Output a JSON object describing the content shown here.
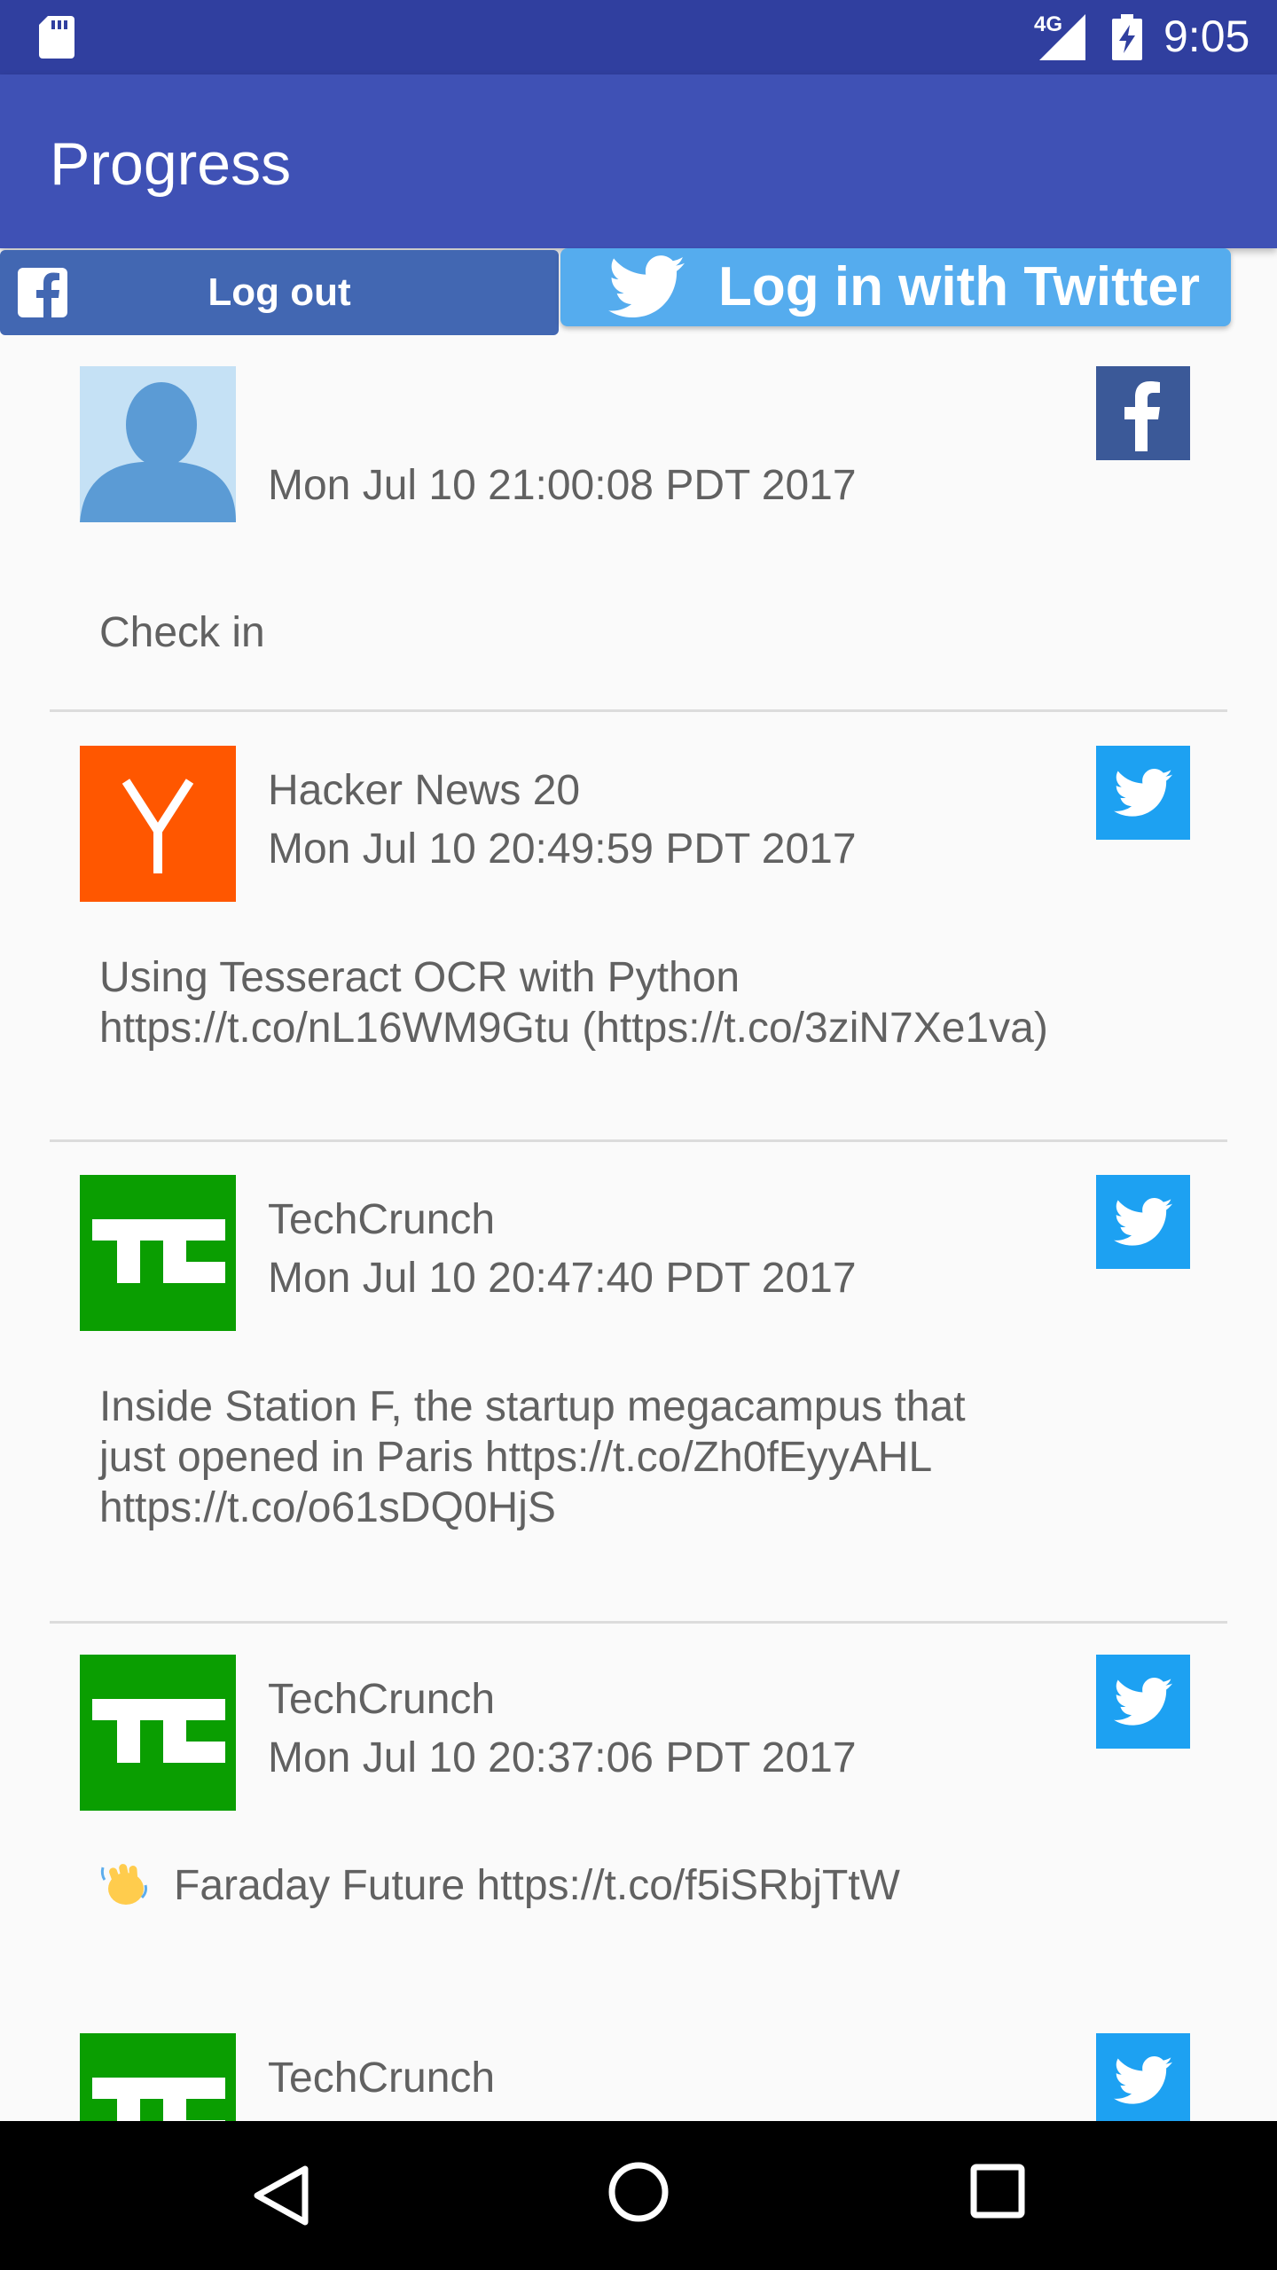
{
  "status_bar": {
    "network": "4G",
    "time": "9:05",
    "icons": [
      "sd-card-icon",
      "signal-icon",
      "battery-charging-icon"
    ]
  },
  "app_bar": {
    "title": "Progress"
  },
  "auth": {
    "facebook_label": "Log out",
    "twitter_label": "Log in with Twitter"
  },
  "feed": [
    {
      "name": "",
      "date": "Mon Jul 10 21:00:08 PDT 2017",
      "text_lines": [
        "Check in"
      ],
      "source": "facebook",
      "avatar": "default-user-avatar"
    },
    {
      "name": "Hacker News 20",
      "date": "Mon Jul 10 20:49:59 PDT 2017",
      "text_lines": [
        "Using Tesseract OCR with Python",
        "https://t.co/nL16WM9Gtu (https://t.co/3ziN7Xe1va)"
      ],
      "source": "twitter",
      "avatar": "hacker-news-logo"
    },
    {
      "name": "TechCrunch",
      "date": "Mon Jul 10 20:47:40 PDT 2017",
      "text_lines": [
        "Inside Station F, the startup megacampus that",
        "just opened in Paris https://t.co/Zh0fEyyAHL",
        "https://t.co/o61sDQ0HjS"
      ],
      "source": "twitter",
      "avatar": "techcrunch-logo"
    },
    {
      "name": "TechCrunch",
      "date": "Mon Jul 10 20:37:06 PDT 2017",
      "text_lines": [
        "Faraday Future https://t.co/f5iSRbjTtW"
      ],
      "source": "twitter",
      "avatar": "techcrunch-logo",
      "emoji": "waving-hand-emoji"
    },
    {
      "name": "TechCrunch",
      "date": "",
      "text_lines": [],
      "source": "twitter",
      "avatar": "techcrunch-logo"
    }
  ],
  "colors": {
    "status_bar": "#303f9f",
    "app_bar": "#3f51b5",
    "facebook": "#4267b2",
    "twitter": "#55acee",
    "hacker_news": "#ff5700",
    "techcrunch": "#0a9e01"
  }
}
